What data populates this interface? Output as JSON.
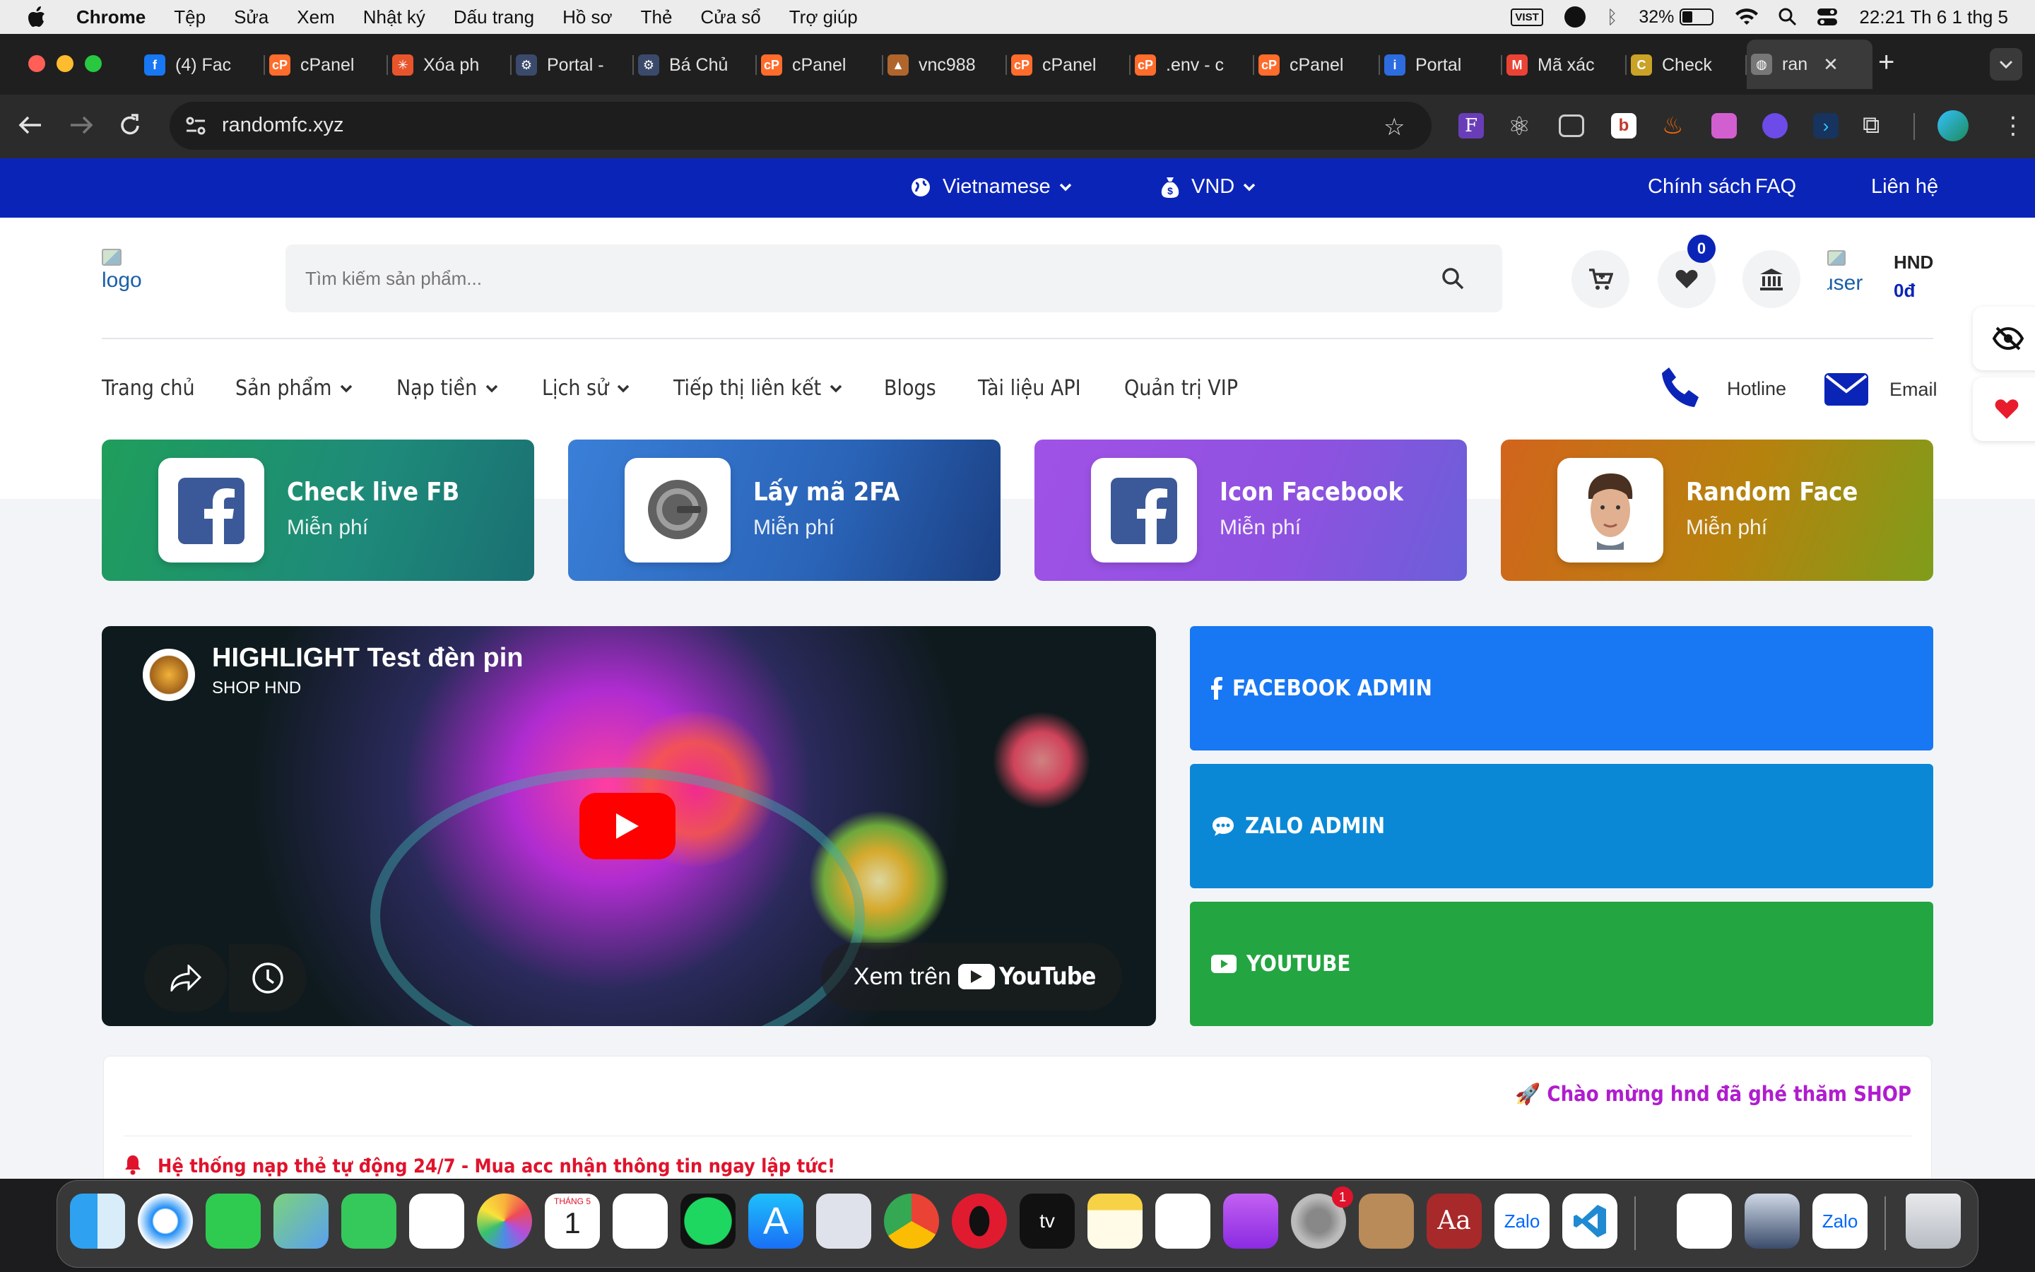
{
  "menubar": {
    "app": "Chrome",
    "items": [
      "Tệp",
      "Sửa",
      "Xem",
      "Nhật ký",
      "Dấu trang",
      "Hồ sơ",
      "Thẻ",
      "Cửa sổ",
      "Trợ giúp"
    ],
    "vist": "VIST",
    "battery": "32%",
    "clock": "22:21 Th 6 1 thg 5"
  },
  "tabs": [
    {
      "title": "(4) Fac",
      "icon": "facebook-icon",
      "color": "#1877f2",
      "letter": "f"
    },
    {
      "title": "cPanel",
      "icon": "cpanel-icon",
      "color": "#ff6c2c",
      "letter": "cP"
    },
    {
      "title": "Xóa ph",
      "icon": "sparkle-icon",
      "color": "#e8552c",
      "letter": "✳"
    },
    {
      "title": "Portal -",
      "icon": "portal-icon",
      "color": "#3b4a6b",
      "letter": "⚙"
    },
    {
      "title": "Bá Chủ",
      "icon": "portal-icon",
      "color": "#3b4a6b",
      "letter": "⚙"
    },
    {
      "title": "cPanel",
      "icon": "cpanel-icon",
      "color": "#ff6c2c",
      "letter": "cP"
    },
    {
      "title": "vnc988",
      "icon": "vnc-icon",
      "color": "#b0652d",
      "letter": "▲"
    },
    {
      "title": "cPanel",
      "icon": "cpanel-icon",
      "color": "#ff6c2c",
      "letter": "cP"
    },
    {
      "title": ".env - c",
      "icon": "cpanel-icon",
      "color": "#ff6c2c",
      "letter": "cP"
    },
    {
      "title": "cPanel",
      "icon": "cpanel-icon",
      "color": "#ff6c2c",
      "letter": "cP"
    },
    {
      "title": "Portal",
      "icon": "info-icon",
      "color": "#2d6cdf",
      "letter": "i"
    },
    {
      "title": "Mã xác",
      "icon": "gmail-icon",
      "color": "#ea4335",
      "letter": "M"
    },
    {
      "title": "Check",
      "icon": "check-icon",
      "color": "#c9a227",
      "letter": "C"
    },
    {
      "title": "ran",
      "icon": "globe-icon",
      "color": "#777",
      "letter": "◍"
    }
  ],
  "address": "randomfc.xyz",
  "topbar": {
    "language": "Vietnamese",
    "currency": "VND",
    "links": [
      "Chính sách",
      "FAQ",
      "Liên hệ"
    ]
  },
  "header": {
    "logo_alt": "logo",
    "search_placeholder": "Tìm kiếm sản phẩm...",
    "wishlist_count": "0",
    "user_alt": "user",
    "username": "HND",
    "balance": "0đ"
  },
  "nav": {
    "items": [
      "Trang chủ",
      "Sản phẩm",
      "Nạp tiền",
      "Lịch sử",
      "Tiếp thị liên kết",
      "Blogs",
      "Tài liệu API",
      "Quản trị VIP"
    ],
    "hotline": "Hotline",
    "email": "Email"
  },
  "cards": [
    {
      "title": "Check live FB",
      "sub": "Miễn phí"
    },
    {
      "title": "Lấy mã 2FA",
      "sub": "Miễn phí"
    },
    {
      "title": "Icon Facebook",
      "sub": "Miễn phí"
    },
    {
      "title": "Random Face",
      "sub": "Miễn phí"
    }
  ],
  "video": {
    "title": "HIGHLIGHT Test đèn pin",
    "channel": "SHOP HND",
    "watch_on": "Xem trên",
    "youtube": "YouTube"
  },
  "buttons": [
    "FACEBOOK ADMIN",
    "ZALO ADMIN",
    "YOUTUBE"
  ],
  "welcome": "🚀 Chào mừng hnd đã ghé thăm SHOP",
  "notice": "Hệ thống nạp thẻ tự động 24/7 - Mua acc nhận thông tin ngay lập tức!",
  "dock": {
    "calendar_month": "THÁNG 5",
    "calendar_day": "1",
    "settings_badge": "1",
    "dictionary": "Aa",
    "zalo": "Zalo",
    "tv": "tv"
  },
  "colors": {
    "brand": "#0b24b8",
    "facebook_btn": "#1877f2",
    "zalo_btn": "#0a88d6",
    "youtube_btn": "#23a541"
  }
}
